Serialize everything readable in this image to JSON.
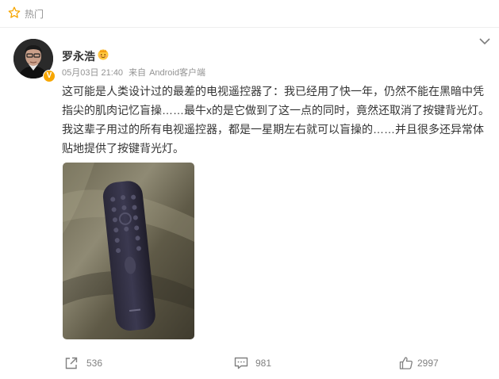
{
  "topbar": {
    "label": "热门",
    "icon": "star-outline-icon"
  },
  "post": {
    "username": "罗永浩",
    "badge_icon": "crown-emoji-icon",
    "verified_badge": "V",
    "time": "05月03日 21:40",
    "source_prefix": "来自",
    "source": "Android客户端",
    "text": "这可能是人类设计过的最差的电视遥控器了：我已经用了快一年，仍然不能在黑暗中凭指尖的肌肉记忆盲操……最牛x的是它做到了这一点的同时，竟然还取消了按键背光灯。我这辈子用过的所有电视遥控器，都是一星期左右就可以盲操的……并且很多还异常体贴地提供了按键背光灯。"
  },
  "actions": {
    "share_count": "536",
    "comment_count": "981",
    "like_count": "2997"
  },
  "colors": {
    "meta": "#939393",
    "text": "#333333",
    "accent": "#f7a600"
  }
}
